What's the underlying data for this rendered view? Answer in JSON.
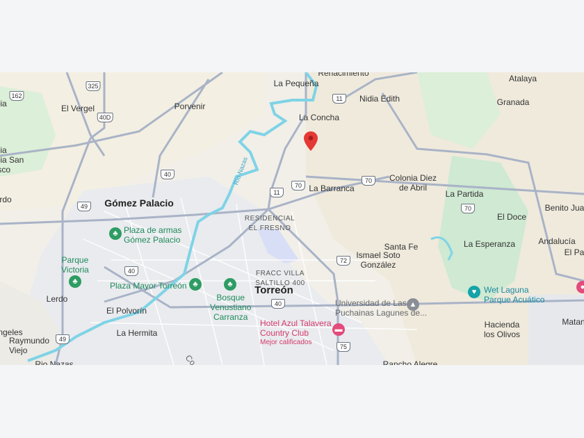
{
  "map": {
    "labels": {
      "renacimiento": "Renacimiento",
      "la_pequena": "La Pequeña",
      "atalaya": "Atalaya",
      "nidia_edith": "Nidia Edith",
      "el_vergel": "El Vergel",
      "porvenir": "Porvenir",
      "granada": "Granada",
      "la_concha": "La Concha",
      "ia_left": "ia",
      "nia_san_isco": "nia\nnia San\nisco",
      "colonia_diez": "Colonia Diez\nde Abril",
      "la_barranca": "La Barranca",
      "la_partida": "La Partida",
      "rdo": "rdo",
      "gomez_palacio": "Gómez Palacio",
      "benito_jua": "Benito Jua",
      "el_doce": "El Doce",
      "residencial": "RESIDENCIAL\nEL FRESNO",
      "plaza_armas": "Plaza de armas\nGómez Palacio",
      "santa_fe": "Santa Fe",
      "la_esperanza": "La Esperanza",
      "andalucia": "Andalucía",
      "el_pa": "El Pa",
      "ismael": "Ismael Soto\nGonzález",
      "parque_victoria": "Parque\nVictoria",
      "fracc_villa": "FRACC VILLA\nSALTILLO 400",
      "plaza_mayor": "Plaza Mayor Torreón",
      "torreon": "Torreón",
      "wet_laguna": "Wet Laguna\nParque Acuático",
      "lerdo": "Lerdo",
      "bosque": "Bosque\nVenustiano\nCarranza",
      "universidad": "Universidad de Las\nPuchainas Lagunes de...",
      "el_polvorin": "El Polvorín",
      "hotel": "Hotel Azul Talavera\nCountry Club",
      "hotel_sub": "Mejor calificados",
      "hacienda": "Hacienda\nlos Olivos",
      "matan": "Matan",
      "angeles": "ngeles",
      "raymundo": "Raymundo\nViejo",
      "la_hermita": "La Hermita",
      "rio_nazas_bottom": "Rio Nazas",
      "rancho_alegre": "Rancho Alegre",
      "rio_nazas_river": "Río Nazas",
      "co": "Co"
    },
    "shields": {
      "s162": "162",
      "s325": "325",
      "s400": "40D",
      "s11a": "11",
      "s40a": "40",
      "s49a": "49",
      "s11b": "11",
      "s70a": "70",
      "s70b": "70",
      "s70c": "70",
      "s72": "72",
      "s40b": "40",
      "s40c": "40",
      "s49b": "49",
      "s75": "75"
    },
    "marker": {
      "color": "#e53935"
    }
  }
}
